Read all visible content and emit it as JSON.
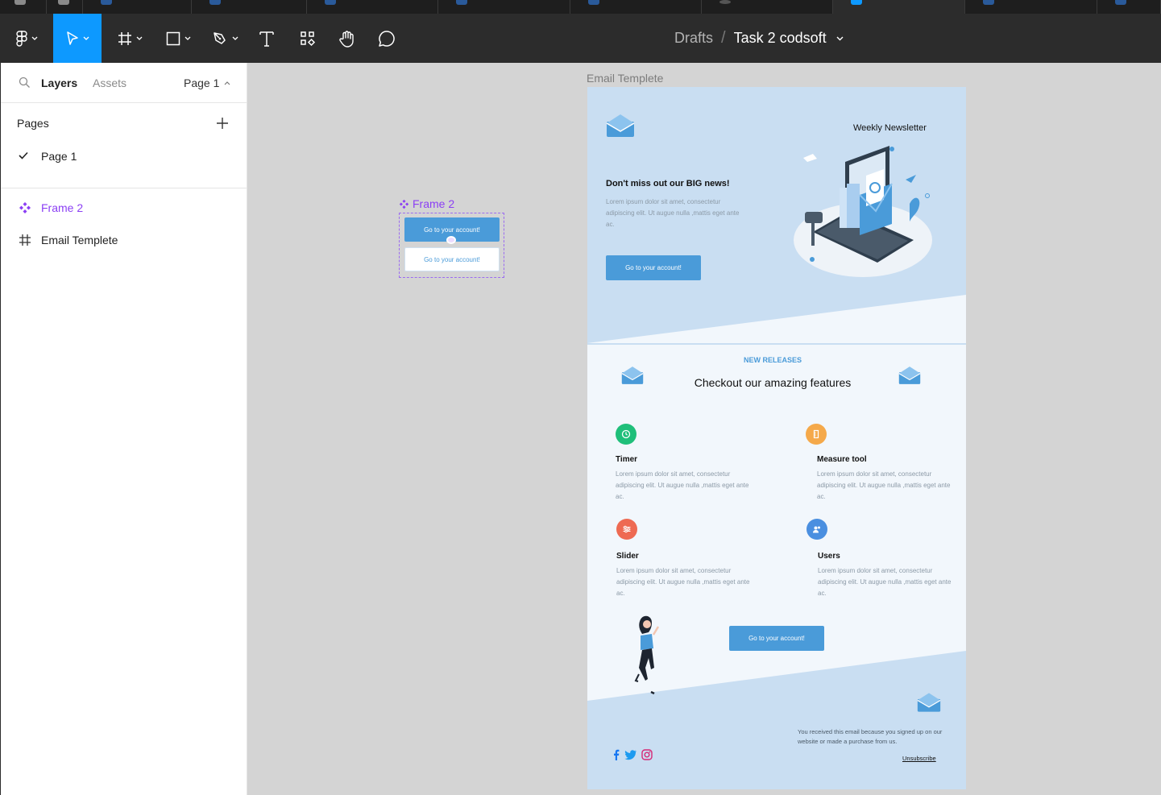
{
  "toolbar": {
    "breadcrumb_root": "Drafts",
    "breadcrumb_sep": "/",
    "file_name": "Task 2 codsoft"
  },
  "left_panel": {
    "tab_layers": "Layers",
    "tab_assets": "Assets",
    "page_selector": "Page 1",
    "pages_heading": "Pages",
    "pages": [
      {
        "label": "Page 1",
        "selected": true
      }
    ],
    "layers": [
      {
        "label": "Frame 2",
        "kind": "component"
      },
      {
        "label": "Email Templete",
        "kind": "frame"
      }
    ]
  },
  "canvas": {
    "frame2": {
      "label": "Frame 2",
      "primary_button": "Go to your account!",
      "secondary_button": "Go to your account!"
    },
    "email": {
      "label": "Email Templete",
      "newsletter": "Weekly Newsletter",
      "headline": "Don't miss out our BIG news!",
      "lorem": "Lorem ipsum dolor sit amet, consectetur adipiscing elit. Ut augue nulla ,mattis eget ante ac.",
      "cta_label": "Go to your account!",
      "section_kicker": "NEW RELEASES",
      "section_title": "Checkout our amazing features",
      "features": [
        {
          "title": "Timer",
          "color": "#1fbf7a",
          "icon": "clock-icon"
        },
        {
          "title": "Measure tool",
          "color": "#f5a94a",
          "icon": "ruler-icon"
        },
        {
          "title": "Slider",
          "color": "#ee6a52",
          "icon": "sliders-icon"
        },
        {
          "title": "Users",
          "color": "#4a8fe0",
          "icon": "users-icon"
        }
      ],
      "cta2_label": "Go to your account!",
      "footer_text": "You received this email because you signed up on our website or made a purchase from us.",
      "unsubscribe": "Unsubscribe"
    }
  },
  "colors": {
    "accent": "#0d99ff",
    "component": "#8b3ff4",
    "email_blue": "#4a9bd9",
    "email_bg": "#c9def2"
  }
}
